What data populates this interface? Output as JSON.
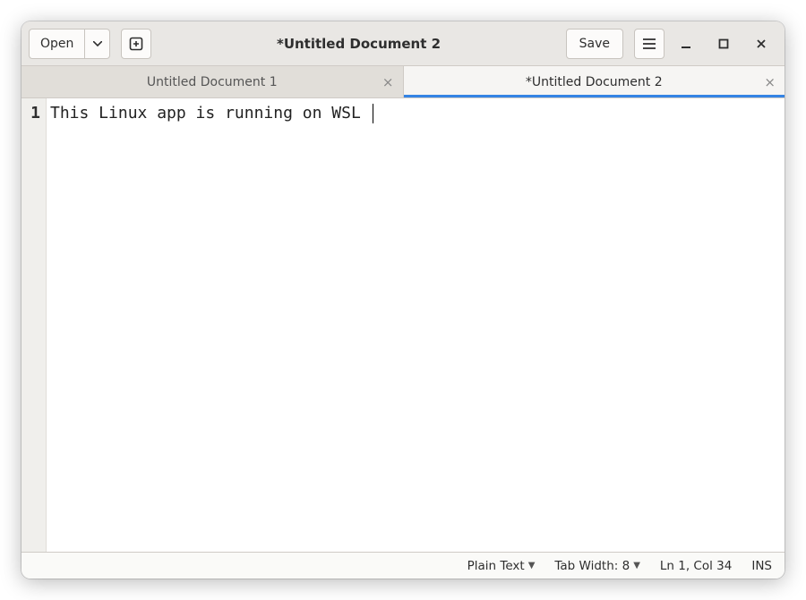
{
  "header": {
    "open_label": "Open",
    "save_label": "Save",
    "title": "*Untitled Document 2"
  },
  "tabs": [
    {
      "label": "Untitled Document 1",
      "active": false
    },
    {
      "label": "*Untitled Document 2",
      "active": true
    }
  ],
  "editor": {
    "line_number": "1",
    "content": "This Linux app is running on WSL "
  },
  "statusbar": {
    "syntax": "Plain Text",
    "tab_width": "Tab Width: 8",
    "position": "Ln 1, Col 34",
    "mode": "INS"
  }
}
